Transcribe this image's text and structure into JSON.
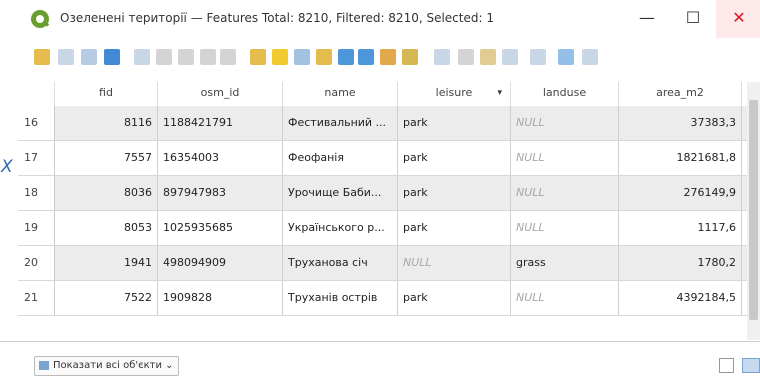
{
  "window": {
    "title": "Озеленені території — Features Total: 8210, Filtered: 8210, Selected: 1",
    "minimize": "—",
    "maximize": "☐",
    "close": "✕"
  },
  "toolbar": {
    "icons": [
      "toggle-editing-icon",
      "multi-edit-icon",
      "save-edits-icon",
      "reload-icon",
      "add-feature-icon",
      "delete-feature-icon",
      "cut-icon",
      "copy-icon",
      "paste-icon",
      "expression-select-icon",
      "select-all-icon",
      "invert-selection-icon",
      "deselect-icon",
      "filter-icon",
      "move-selection-top-icon",
      "pan-to-selection-icon",
      "zoom-to-selection-icon",
      "new-field-icon",
      "delete-field-icon",
      "field-calculator-icon",
      "conditional-format-icon",
      "dock-icon",
      "actions-icon",
      "dev-icon"
    ]
  },
  "marker": "X",
  "table": {
    "columns": [
      "fid",
      "osm_id",
      "name",
      "leisure",
      "landuse",
      "area_m2"
    ],
    "sorted_column": "leisure",
    "rows": [
      {
        "row": "16",
        "fid": "8116",
        "osm_id": "1188421791",
        "name": "Фестивальний ...",
        "leisure": "park",
        "landuse": "NULL",
        "area_m2": "37383,3"
      },
      {
        "row": "17",
        "fid": "7557",
        "osm_id": "16354003",
        "name": "Феофанія",
        "leisure": "park",
        "landuse": "NULL",
        "area_m2": "1821681,8"
      },
      {
        "row": "18",
        "fid": "8036",
        "osm_id": "897947983",
        "name": "Урочище Баби...",
        "leisure": "park",
        "landuse": "NULL",
        "area_m2": "276149,9"
      },
      {
        "row": "19",
        "fid": "8053",
        "osm_id": "1025935685",
        "name": "Українського р...",
        "leisure": "park",
        "landuse": "NULL",
        "area_m2": "1117,6"
      },
      {
        "row": "20",
        "fid": "1941",
        "osm_id": "498094909",
        "name": "Труханова січ",
        "leisure": "NULL",
        "landuse": "grass",
        "area_m2": "1780,2"
      },
      {
        "row": "21",
        "fid": "7522",
        "osm_id": "1909828",
        "name": "Труханів острів",
        "leisure": "park",
        "landuse": "NULL",
        "area_m2": "4392184,5"
      }
    ]
  },
  "footer": {
    "show_all_label": "Показати всі об'єкти"
  }
}
